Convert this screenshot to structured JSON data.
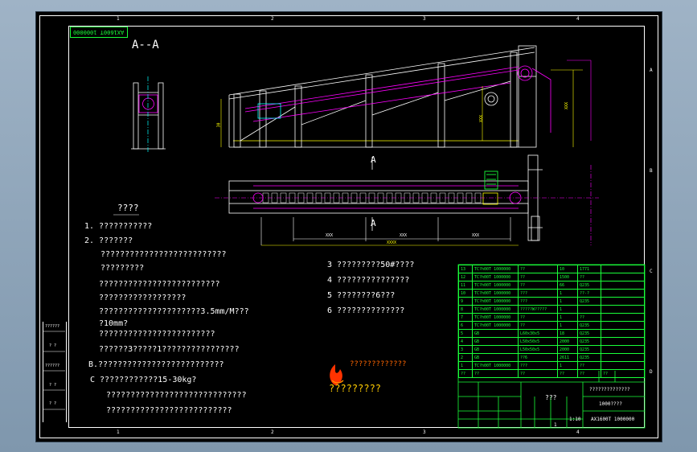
{
  "drawing_number_stamp": "AX1600T 1000000",
  "section_label": "A--A",
  "cut_marker": "A",
  "zone_numbers_top": [
    "1",
    "2",
    "3",
    "4"
  ],
  "zone_numbers_bottom": [
    "1",
    "2",
    "3",
    "4"
  ],
  "zone_letters_right": [
    "A",
    "B",
    "C",
    "D"
  ],
  "dimensions": {
    "height_left": "30",
    "span_1": "XXX",
    "span_2": "XXX",
    "span_3": "XXX",
    "overall": "XXXX",
    "vert_1": "XXX",
    "vert_2": "XXX"
  },
  "notes": {
    "title": "????",
    "lines": [
      "1.   ???????????",
      "2.   ???????",
      "??????????????????????????",
      "?????????",
      "?????????????????????????",
      "??????????????????",
      "?????????????????????3.5mm/M???",
      "?10mm?",
      "????????????????????????",
      "??????3?????1????????????????",
      "B.??????????????????????????",
      "C ????????????15-30kg?",
      "?????????????????????????????",
      "??????????????????????????"
    ],
    "right_lines": [
      "3   ?????????50#????",
      "4   ???????????????",
      "5   ????????6???",
      "6   ??????????????"
    ]
  },
  "watermark": {
    "line1": "?????????????",
    "line2": "?????????"
  },
  "bom_rows": [
    [
      "13",
      "TC?h00T 1000000",
      "??",
      "10",
      "1771",
      ""
    ],
    [
      "12",
      "TC?h00T 1000000",
      "??",
      "1500",
      "??",
      ""
    ],
    [
      "11",
      "TC?h00T 1000000",
      "??",
      "66",
      "Q235",
      ""
    ],
    [
      "10",
      "TC?h00T 1000000",
      "???",
      "1",
      "??-?",
      ""
    ],
    [
      "9",
      "TC?h00T 1000000",
      "???",
      "1",
      "Q235",
      ""
    ],
    [
      "8",
      "TC?h00T 1000000",
      "?????W?????",
      "1",
      "",
      ""
    ],
    [
      "7",
      "TC?h00T 1000000",
      "??",
      "1",
      "??",
      ""
    ],
    [
      "6",
      "TC?h00T 1000000",
      "??",
      "1",
      "Q235",
      ""
    ],
    [
      "5",
      "GB",
      "L60x30x5",
      "18",
      "Q235",
      ""
    ],
    [
      "4",
      "GB",
      "L50x50x5",
      "2000",
      "Q235",
      ""
    ],
    [
      "3",
      "GB",
      "L50x50x5",
      "2000",
      "Q235",
      ""
    ],
    [
      "2",
      "GB",
      "??6",
      "2611",
      "Q235",
      ""
    ],
    [
      "1",
      "TC?h00T 1000000",
      "???",
      "1",
      "??",
      ""
    ],
    [
      "??",
      "??",
      "??",
      "??",
      "??",
      "??"
    ]
  ],
  "title_block": {
    "company": "??????????????",
    "drawing_name": "???",
    "product": "1000????",
    "drawing_no": "AX1600T 1000000",
    "scale": "1:10",
    "sheet": "1"
  },
  "left_revision_labels": [
    "??????",
    "? ?",
    "??????",
    "? ?",
    "? ?"
  ],
  "colors": {
    "frame": "#ffffff",
    "structure": "#ffffff",
    "magenta": "#ff00ff",
    "yellow": "#ffff00",
    "green": "#19ff39",
    "cyan": "#00ffff",
    "background": "#000000"
  }
}
